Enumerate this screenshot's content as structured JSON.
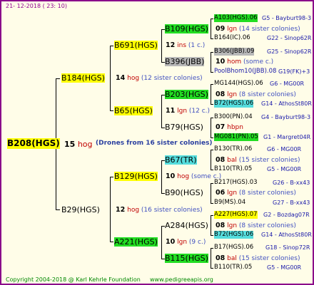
{
  "header": {
    "date": "21- 12-2018 ( 23: 10)"
  },
  "footer": {
    "copyright": "Copyright 2004-2018 @ Karl Kehrle Foundation",
    "site": "www.pedigreeapis.org"
  },
  "root": {
    "name": "B208(HGS)",
    "count": "15",
    "hog": "hog",
    "note": "(Drones from 16 sister colonies)"
  },
  "gen1": {
    "a": {
      "name": "B184(HGS)",
      "count": "14",
      "hog": "hog",
      "note": "(12 sister colonies)"
    },
    "b": {
      "name": "B29(HGS)",
      "count": "12",
      "hog": "hog",
      "note": "(16 sister colonies)"
    }
  },
  "gen2": {
    "a": {
      "name": "B691(HGS)",
      "count": "12",
      "hog": "ins",
      "note": "(1 c.)"
    },
    "b": {
      "name": "B65(HGS)",
      "count": "11",
      "hog": "lgn",
      "note": "(12 c.)"
    },
    "c": {
      "name": "B129(HGS)",
      "count": "10",
      "hog": "hog",
      "note": "(some c.)"
    },
    "d": {
      "name": "A221(HGS)",
      "count": "10",
      "hog": "lgn",
      "note": "(9 c.)"
    }
  },
  "gen3": {
    "a": {
      "name": "B109(HGS)",
      "count": "09",
      "hog": "lgn",
      "note": "(14 sister colonies)"
    },
    "b": {
      "name": "B396(JBB)",
      "count": "10",
      "hog": "hom",
      "note": "(some c.)"
    },
    "c": {
      "name": "B203(HGS)",
      "count": "08",
      "hog": "lgn",
      "note": "(8 sister colonies)"
    },
    "d": {
      "name": "B79(HGS)",
      "count": "07",
      "hog": "hbpn",
      "note": ""
    },
    "e": {
      "name": "B67(TR)",
      "count": "08",
      "hog": "bal",
      "note": "(15 sister colonies)"
    },
    "f": {
      "name": "B90(HGS)",
      "count": "06",
      "hog": "lgn",
      "note": "(8 sister colonies)"
    },
    "g": {
      "name": "A284(HGS)",
      "count": "08",
      "hog": "lgn",
      "note": "(8 sister colonies)"
    },
    "h": {
      "name": "B115(HGS)",
      "count": "08",
      "hog": "bal",
      "note": "(15 sister colonies)"
    }
  },
  "gen4": {
    "a": {
      "name": "A103(HGS).06",
      "info": "G5 - Bayburt98-3"
    },
    "b": {
      "name": "B164(IC).06",
      "info": "G22 - Sinop62R"
    },
    "c": {
      "name": "B306(JBB).09",
      "info": "G25 - Sinop62R"
    },
    "d": {
      "name": "PoolBhom10(JBB).08",
      "info": "G19(FK)+3"
    },
    "e": {
      "name": "MG144(HGS).06",
      "info": "G6 - MG00R"
    },
    "f": {
      "name": "B72(HGS).06",
      "info": "G14 - AthosSt80R"
    },
    "g": {
      "name": "B300(PN).04",
      "info": "G4 - Bayburt98-3"
    },
    "h": {
      "name": "MG081(PN).05",
      "info": "G1 - Margret04R"
    },
    "i": {
      "name": "B130(TR).06",
      "info": "G6 - MG00R"
    },
    "j": {
      "name": "B110(TR).05",
      "info": "G5 - MG00R"
    },
    "k": {
      "name": "B217(HGS).03",
      "info": "G26 - B-xx43"
    },
    "l": {
      "name": "B9(MS).04",
      "info": "G27 - B-xx43"
    },
    "m": {
      "name": "A227(HGS).07",
      "info": "G2 - Bozdag07R"
    },
    "n": {
      "name": "B72(HGS).06",
      "info": "G14 - AthosSt80R"
    },
    "o": {
      "name": "B17(HGS).06",
      "info": "G18 - Sinop72R"
    },
    "p": {
      "name": "B110(TR).05",
      "info": "G5 - MG00R"
    }
  },
  "colors": {
    "frame": "#8a0a8a",
    "yellow": "#ffff00",
    "green": "#22dd22",
    "cyan": "#55dddd",
    "gray": "#b8b8b8",
    "hog": "#c00000",
    "note": "#4050c0",
    "info": "#1a1aaa",
    "footer": "#008800"
  }
}
